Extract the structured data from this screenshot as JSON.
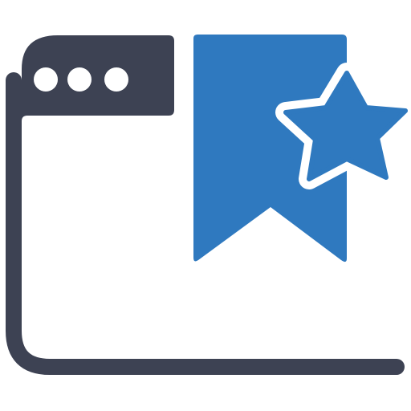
{
  "icon": {
    "name": "bookmark-browser-star-icon",
    "parts": [
      "browser-window-icon",
      "bookmark-icon",
      "star-icon"
    ]
  },
  "colors": {
    "background": "#ffffff",
    "frame": "#3d4253",
    "accent": "#2f79bf",
    "dots": "#ffffff",
    "star_outline": "#ffffff"
  }
}
